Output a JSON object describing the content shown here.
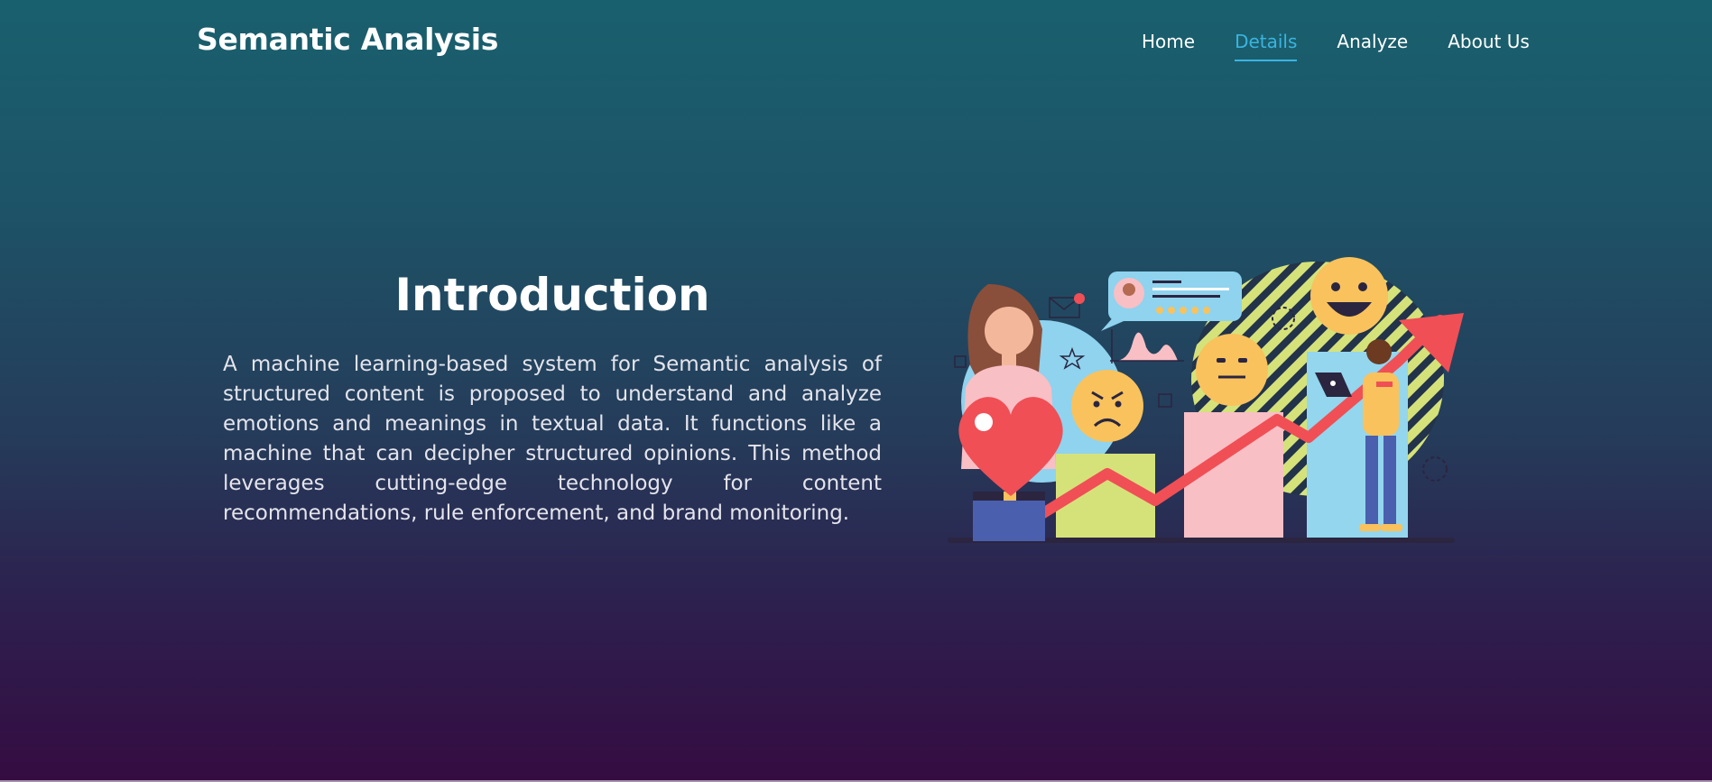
{
  "header": {
    "brand": "Semantic Analysis",
    "nav": [
      {
        "label": "Home",
        "active": false
      },
      {
        "label": "Details",
        "active": true
      },
      {
        "label": "Analyze",
        "active": false
      },
      {
        "label": "About Us",
        "active": false
      }
    ]
  },
  "intro": {
    "title": "Introduction",
    "body": "A machine learning-based system for Semantic analysis of structured content is proposed to understand and analyze emotions and meanings in textual data. It functions like a machine that can decipher structured opinions. This method leverages cutting-edge technology for content recommendations, rule enforcement, and brand monitoring."
  },
  "illustration": {
    "icons": [
      "woman-holding-heart",
      "angry-emoji",
      "neutral-emoji",
      "happy-emoji",
      "review-bubble",
      "growth-arrow",
      "man-with-laptop",
      "mail-icon",
      "star-icon",
      "gear-icon",
      "checkbox-icon"
    ]
  },
  "colors": {
    "accent": "#3ab4e0",
    "heart": "#f04f56",
    "emoji": "#f9c25c",
    "bar_green": "#d5e27a",
    "bar_pink": "#f8bfc5",
    "bar_blue": "#93d6ee"
  }
}
